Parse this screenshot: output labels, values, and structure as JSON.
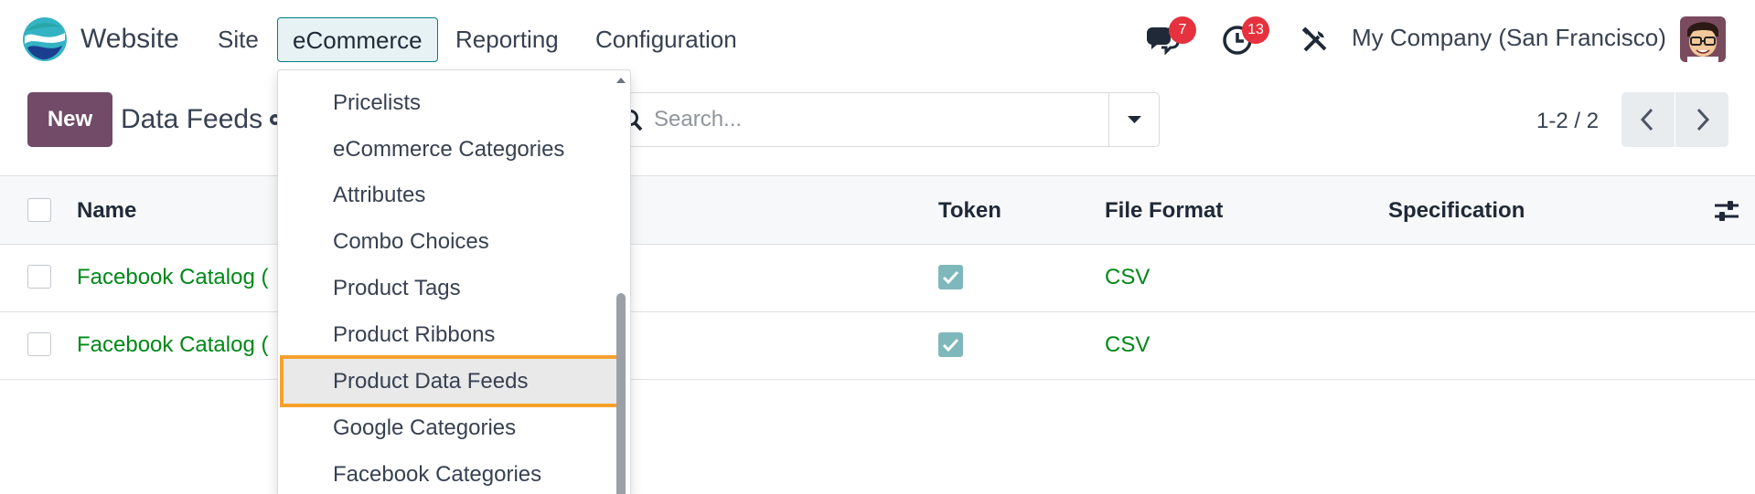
{
  "navbar": {
    "app_name": "Website",
    "menus": [
      "Site",
      "eCommerce",
      "Reporting",
      "Configuration"
    ],
    "active_menu": "eCommerce",
    "messages_badge": "7",
    "activities_badge": "13",
    "company": "My Company (San Francisco)"
  },
  "control_panel": {
    "new_label": "New",
    "breadcrumb": "Data Feeds",
    "search_placeholder": "Search...",
    "pager": "1-2 / 2"
  },
  "table": {
    "columns": [
      "Name",
      "Token",
      "File Format",
      "Specification"
    ],
    "rows": [
      {
        "name": "Facebook Catalog (",
        "token": true,
        "file_format": "CSV",
        "specification": ""
      },
      {
        "name": "Facebook Catalog (",
        "token": true,
        "file_format": "CSV",
        "specification": ""
      }
    ]
  },
  "dropdown": {
    "items": [
      "Pricelists",
      "eCommerce Categories",
      "Attributes",
      "Combo Choices",
      "Product Tags",
      "Product Ribbons",
      "Product Data Feeds",
      "Google Categories",
      "Facebook Categories"
    ],
    "selected": "Product Data Feeds"
  },
  "colors": {
    "brand_primary": "#714b67",
    "active_menu_border": "#017e84",
    "link_green": "#008818",
    "badge_red": "#e5323e",
    "highlight_orange": "#f7a12c",
    "checkbox_teal": "#7fb8bb"
  },
  "icons": [
    "website-logo",
    "chat-icon",
    "clock-icon",
    "tools-icon",
    "avatar",
    "gear-icon",
    "search-icon",
    "caret-down-icon",
    "chevron-left-icon",
    "chevron-right-icon",
    "optional-columns-icon",
    "check-icon",
    "scroll-up-icon"
  ]
}
